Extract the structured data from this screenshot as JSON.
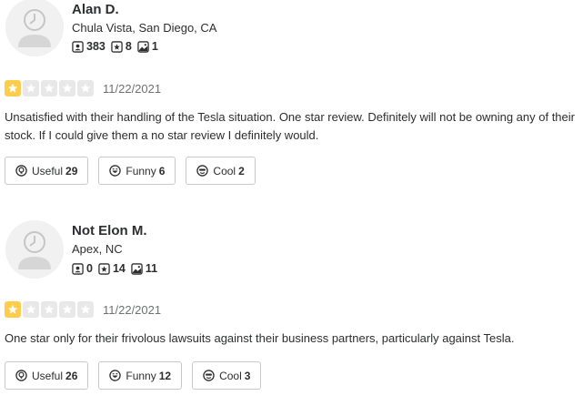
{
  "reviews": [
    {
      "user": {
        "name": "Alan D.",
        "location": "Chula Vista, San Diego, CA",
        "friends": "383",
        "reviews": "8",
        "photos": "1"
      },
      "rating": 1,
      "date": "11/22/2021",
      "text": "Unsatisfied with their handling of the Tesla situation. One star review. Definitely will not be owning any of their stock. If I could give them a no star review I definitely would.",
      "reactions": {
        "useful_label": "Useful",
        "useful_count": "29",
        "funny_label": "Funny",
        "funny_count": "6",
        "cool_label": "Cool",
        "cool_count": "2"
      }
    },
    {
      "user": {
        "name": "Not Elon M.",
        "location": "Apex, NC",
        "friends": "0",
        "reviews": "14",
        "photos": "11"
      },
      "rating": 1,
      "date": "11/22/2021",
      "text": "One star only for their frivolous lawsuits against their business partners, particularly against Tesla.",
      "reactions": {
        "useful_label": "Useful",
        "useful_count": "26",
        "funny_label": "Funny",
        "funny_count": "12",
        "cool_label": "Cool",
        "cool_count": "3"
      }
    }
  ],
  "icons": {
    "friends": "friends-icon",
    "reviews": "review-star-icon",
    "photos": "photo-icon",
    "useful": "lightbulb-icon",
    "funny": "funny-face-icon",
    "cool": "cool-face-icon",
    "avatar": "default-avatar-icon"
  },
  "colors": {
    "star_filled": "#ffcc4b",
    "star_empty": "#e8e8e8",
    "text": "#2d2e2f",
    "date": "#6e7072",
    "button_border": "#c8c9ca"
  }
}
